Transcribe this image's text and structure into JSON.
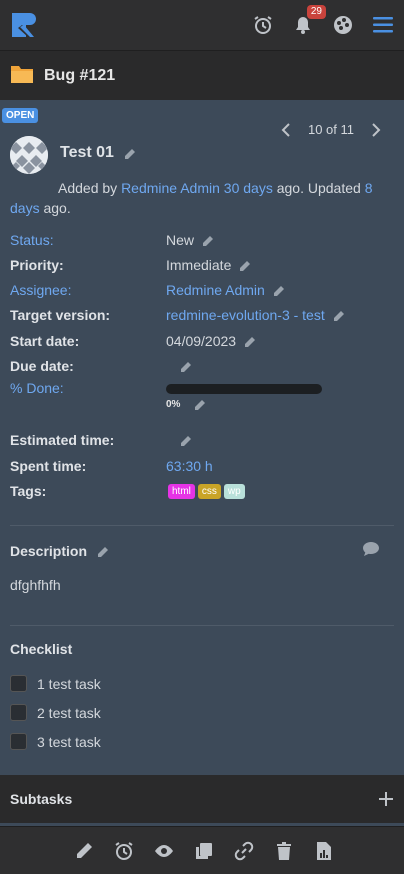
{
  "header": {
    "logo_icon": "redmine-logo-icon",
    "notification_count": "29",
    "icons": [
      "alarm-clock-icon",
      "bell-icon",
      "palette-icon",
      "menu-icon"
    ]
  },
  "titlebar": {
    "title": "Bug #121",
    "icon": "folder-icon"
  },
  "issue": {
    "status_badge": "OPEN",
    "pager": "10 of 11",
    "title": "Test 01",
    "added_prefix": "Added by",
    "author": "Redmine Admin",
    "created_ago": "30 days",
    "updated_text": "ago. Updated",
    "updated_ago": "8 days",
    "suffix": "ago."
  },
  "attributes": {
    "status": {
      "label": "Status:",
      "value": "New"
    },
    "priority": {
      "label": "Priority:",
      "value": "Immediate"
    },
    "assignee": {
      "label": "Assignee:",
      "value": "Redmine Admin"
    },
    "target_version": {
      "label": "Target version:",
      "value": "redmine-evolution-3 - test"
    },
    "start_date": {
      "label": "Start date:",
      "value": "04/09/2023"
    },
    "due_date": {
      "label": "Due date:",
      "value": ""
    },
    "done": {
      "label": "% Done:",
      "value": "0%",
      "fraction": 0
    },
    "estimated_time": {
      "label": "Estimated time:",
      "value": ""
    },
    "spent_time": {
      "label": "Spent time:",
      "value": "63:30 h"
    },
    "tags": {
      "label": "Tags:",
      "items": [
        {
          "text": "html",
          "color": "#e633e6"
        },
        {
          "text": "css",
          "color": "#c9a427"
        },
        {
          "text": "wp",
          "color": "#b9e0da"
        }
      ]
    }
  },
  "description": {
    "title": "Description",
    "text": "dfghfhfh"
  },
  "checklist": {
    "title": "Checklist",
    "items": [
      "1 test task",
      "2 test task",
      "3 test task"
    ]
  },
  "subtasks": {
    "title": "Subtasks"
  },
  "bottom_toolbar": [
    "edit-icon",
    "alarm-clock-icon",
    "eye-icon",
    "copy-icon",
    "link-icon",
    "trash-icon",
    "pdf-icon"
  ],
  "colors": {
    "accent": "#6fa8f0",
    "badge": "#c9433c",
    "status_badge": "#4a90e2"
  }
}
